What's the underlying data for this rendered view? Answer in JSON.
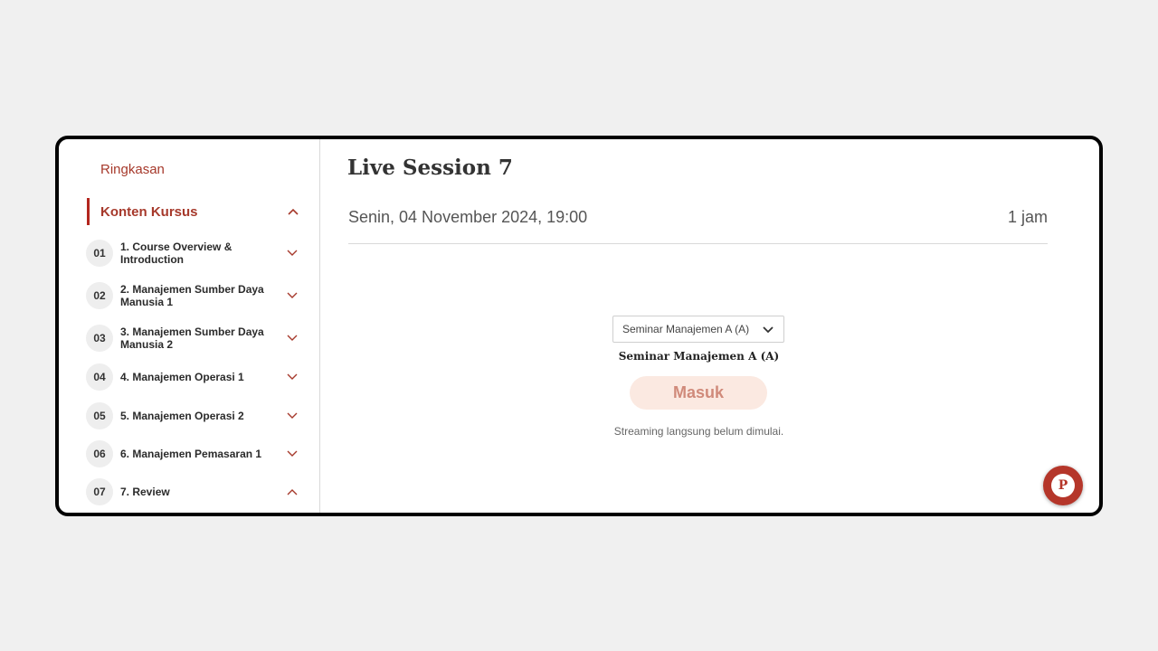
{
  "sidebar": {
    "summary_label": "Ringkasan",
    "section": {
      "title": "Konten Kursus",
      "expanded": true
    },
    "modules": [
      {
        "number": "01",
        "title": "1. Course Overview & Introduction",
        "expanded": false
      },
      {
        "number": "02",
        "title": "2. Manajemen Sumber Daya Manusia 1",
        "expanded": false
      },
      {
        "number": "03",
        "title": "3. Manajemen Sumber Daya Manusia 2",
        "expanded": false
      },
      {
        "number": "04",
        "title": "4. Manajemen Operasi 1",
        "expanded": false
      },
      {
        "number": "05",
        "title": "5. Manajemen Operasi 2",
        "expanded": false
      },
      {
        "number": "06",
        "title": "6. Manajemen Pemasaran 1",
        "expanded": false
      },
      {
        "number": "07",
        "title": "7. Review",
        "expanded": true
      }
    ]
  },
  "main": {
    "title": "Live Session 7",
    "date": "Senin, 04 November 2024, 19:00",
    "duration": "1 jam",
    "session_select": {
      "selected": "Seminar Manajemen A (A)"
    },
    "seminar_name": "Seminar Manajemen A (A)",
    "join_label": "Masuk",
    "status_text": "Streaming langsung belum dimulai.",
    "chat_icon_letter": "P"
  },
  "colors": {
    "accent": "#a6392b",
    "button_bg": "#fbe9e1",
    "button_text": "#d08a7a",
    "fab": "#b5362a"
  },
  "icons": {
    "expand": "chevron-down-icon",
    "collapse": "chevron-up-icon",
    "chat": "chat-support-icon"
  }
}
